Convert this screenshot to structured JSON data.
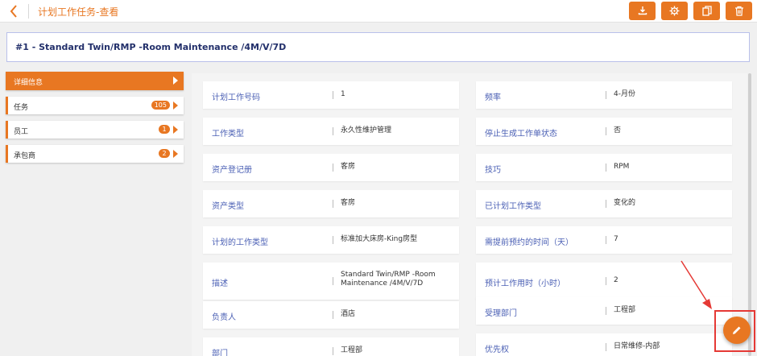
{
  "header": {
    "title": "计划工作任务-查看",
    "actions": [
      {
        "name": "download-button",
        "icon": "download-icon"
      },
      {
        "name": "settings-button",
        "icon": "gear-icon"
      },
      {
        "name": "copy-button",
        "icon": "copy-icon"
      },
      {
        "name": "delete-button",
        "icon": "trash-icon"
      }
    ],
    "accent_color": "#e87722"
  },
  "record": {
    "title": "#1 - Standard Twin/RMP -Room Maintenance /4M/V/7D"
  },
  "sidebar": {
    "items": [
      {
        "label": "详细信息",
        "active": true
      },
      {
        "label": "任务",
        "count": "105"
      },
      {
        "label": "员工",
        "count": "1"
      },
      {
        "label": "承包商",
        "count": "2"
      }
    ]
  },
  "details": {
    "left": [
      {
        "label": "计划工作号码",
        "value": "1"
      },
      {
        "label": "工作类型",
        "value": "永久性维护管理"
      },
      {
        "label": "资产登记册",
        "value": "客房"
      },
      {
        "label": "资产类型",
        "value": "客房"
      },
      {
        "label": "计划的工作类型",
        "value": "标准加大床房-King房型"
      },
      {
        "label": "描述",
        "value": "Standard Twin/RMP -Room Maintenance /4M/V/7D"
      },
      {
        "label": "负责人",
        "value": "酒店"
      },
      {
        "label": "部门",
        "value": "工程部"
      }
    ],
    "right": [
      {
        "label": "频率",
        "value": "4-月份"
      },
      {
        "label": "停止生成工作单状态",
        "value": "否"
      },
      {
        "label": "技巧",
        "value": "RPM"
      },
      {
        "label": "已计划工作类型",
        "value": "变化的"
      },
      {
        "label": "需提前预约的时间（天）",
        "value": "7"
      },
      {
        "label": "预计工作用时（小时）",
        "value": "2"
      },
      {
        "label": "受理部门",
        "value": "工程部"
      },
      {
        "label": "优先权",
        "value": "日常维修-内部"
      }
    ]
  },
  "fab": {
    "icon": "pencil-icon"
  },
  "annotation": {
    "color": "#e53935"
  }
}
